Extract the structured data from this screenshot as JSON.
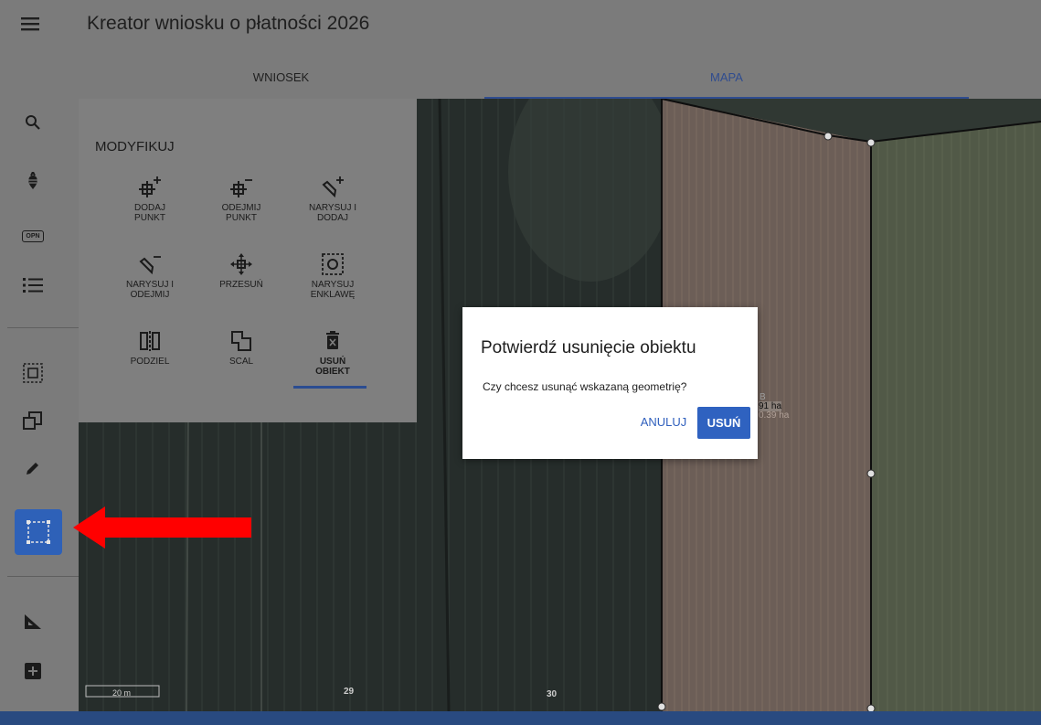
{
  "app": {
    "title": "Kreator wniosku o płatności 2026"
  },
  "tabs": [
    {
      "label": "WNIOSEK"
    },
    {
      "label": "MAPA"
    }
  ],
  "rail": {
    "opn_label": "OPN"
  },
  "panel": {
    "title": "MODYFIKUJ",
    "tools": [
      {
        "label": "DODAJ\nPUNKT",
        "icon": "add-vertex-icon"
      },
      {
        "label": "ODEJMIJ\nPUNKT",
        "icon": "remove-vertex-icon"
      },
      {
        "label": "NARYSUJ I\nDODAJ",
        "icon": "draw-add-icon"
      },
      {
        "label": "NARYSUJ I\nODEJMIJ",
        "icon": "draw-subtract-icon"
      },
      {
        "label": "PRZESUŃ",
        "icon": "move-icon"
      },
      {
        "label": "NARYSUJ\nENKLAWĘ",
        "icon": "enclave-icon"
      },
      {
        "label": "PODZIEL",
        "icon": "split-icon"
      },
      {
        "label": "SCAL",
        "icon": "merge-icon"
      },
      {
        "label": "USUŃ\nOBIEKT",
        "icon": "delete-icon"
      }
    ]
  },
  "dialog": {
    "title": "Potwierdź usunięcie obiektu",
    "message": "Czy chcesz usunąć wskazaną geometrię?",
    "cancel": "ANULUJ",
    "confirm": "USUŃ"
  },
  "map": {
    "scale": "20 m",
    "parcel_labels": [
      "29",
      "30"
    ],
    "area_label": "91 ha",
    "area_label_2": "B",
    "area_label_3": "0.39 ha"
  },
  "colors": {
    "accent": "#2f62c0",
    "annotation_arrow": "#ff0000"
  }
}
